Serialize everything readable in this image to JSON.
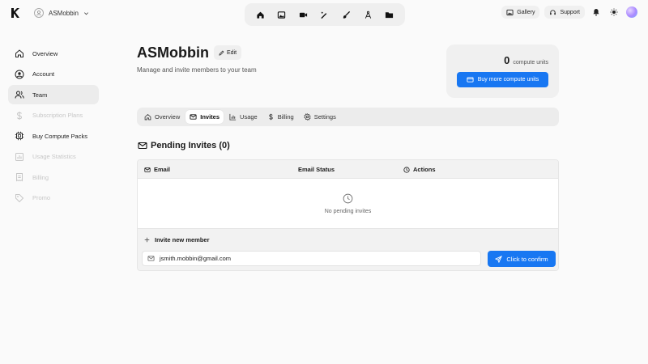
{
  "workspace": {
    "name": "ASMobbin"
  },
  "topbar": {
    "tools": [
      {
        "icon": "home-icon"
      },
      {
        "icon": "image-icon"
      },
      {
        "icon": "video-icon"
      },
      {
        "icon": "wand-icon"
      },
      {
        "icon": "brush-icon"
      },
      {
        "icon": "compass-icon"
      },
      {
        "icon": "folder-icon"
      }
    ],
    "gallery_label": "Gallery",
    "support_label": "Support"
  },
  "sidebar": {
    "items": [
      {
        "label": "Overview",
        "icon": "home-icon",
        "state": "normal"
      },
      {
        "label": "Account",
        "icon": "user-circle-icon",
        "state": "normal"
      },
      {
        "label": "Team",
        "icon": "users-icon",
        "state": "active"
      },
      {
        "label": "Subscription Plans",
        "icon": "dollar-icon",
        "state": "disabled"
      },
      {
        "label": "Buy Compute Packs",
        "icon": "cpu-icon",
        "state": "normal"
      },
      {
        "label": "Usage Statistics",
        "icon": "chart-icon",
        "state": "disabled"
      },
      {
        "label": "Billing",
        "icon": "receipt-icon",
        "state": "disabled"
      },
      {
        "label": "Promo",
        "icon": "tag-icon",
        "state": "disabled"
      }
    ]
  },
  "header": {
    "title": "ASMobbin",
    "edit_label": "Edit",
    "subtitle": "Manage and invite members to your team"
  },
  "compute": {
    "count": "0",
    "unit": "compute units",
    "buy_label": "Buy more compute units"
  },
  "tabs": [
    {
      "label": "Overview",
      "icon": "home-icon",
      "active": false
    },
    {
      "label": "Invites",
      "icon": "mail-icon",
      "active": true
    },
    {
      "label": "Usage",
      "icon": "chart-icon",
      "active": false
    },
    {
      "label": "Billing",
      "icon": "dollar-icon",
      "active": false
    },
    {
      "label": "Settings",
      "icon": "gear-icon",
      "active": false
    }
  ],
  "invites": {
    "title": "Pending Invites (0)",
    "columns": {
      "email": "Email",
      "status": "Email Status",
      "actions": "Actions"
    },
    "empty_text": "No pending invites",
    "invite_label": "Invite new member",
    "email_value": "jsmith.mobbin@gmail.com",
    "confirm_label": "Click to confirm"
  },
  "colors": {
    "accent": "#1877f2",
    "background": "#fafafa"
  }
}
